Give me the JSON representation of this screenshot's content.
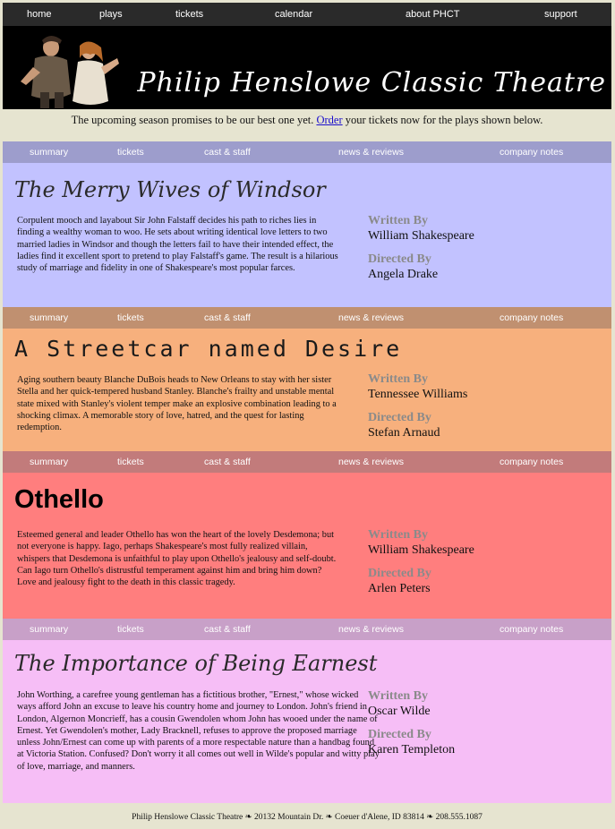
{
  "topnav": [
    "home",
    "plays",
    "tickets",
    "calendar",
    "about PHCT",
    "support"
  ],
  "banner": {
    "title": "Philip Henslowe Classic Theatre"
  },
  "intro": {
    "before": "The upcoming season promises to be our best one yet.",
    "link": "Order",
    "after": "your tickets now for the plays shown below."
  },
  "subnav": [
    "summary",
    "tickets",
    "cast & staff",
    "news & reviews",
    "company notes"
  ],
  "credit_labels": {
    "written": "Written By",
    "directed": "Directed By"
  },
  "plays": [
    {
      "title": "The Merry Wives of Windsor",
      "description": "Corpulent mooch and layabout Sir John Falstaff decides his path to riches lies in finding a wealthy woman to woo. He sets about writing identical love letters to two married ladies in Windsor and though the letters fail to have their intended effect, the ladies find it excellent sport to pretend to play Falstaff's game. The result is a hilarious study of marriage and fidelity in one of Shakespeare's most popular farces.",
      "writer": "William Shakespeare",
      "director": "Angela Drake",
      "colors": {
        "nav": "#9d9dcc",
        "body": "#c2c2ff"
      }
    },
    {
      "title": "A Streetcar named Desire",
      "description": "Aging southern beauty Blanche DuBois heads to New Orleans to stay with her sister Stella and her quick-tempered husband Stanley. Blanche's frailty and unstable mental state mixed with Stanley's violent temper make an explosive combination leading to a shocking climax. A memorable story of love, hatred, and the quest for lasting redemption.",
      "writer": "Tennessee Williams",
      "director": "Stefan Arnaud",
      "colors": {
        "nav": "#c09070",
        "body": "#f7b07d"
      }
    },
    {
      "title": "Othello",
      "description": "Esteemed general and leader Othello has won the heart of the lovely Desdemona; but not everyone is happy. Iago, perhaps Shakespeare's most fully realized villain, whispers that Desdemona is unfaithful to play upon Othello's jealousy and self-doubt. Can Iago turn Othello's distrustful temperament against him and bring him down? Love and jealousy fight to the death in this classic tragedy.",
      "writer": "William Shakespeare",
      "director": "Arlen Peters",
      "colors": {
        "nav": "#c27b7b",
        "body": "#ff7e7e"
      }
    },
    {
      "title": "The Importance of Being Earnest",
      "description": "John Worthing, a carefree young gentleman has a fictitious brother, \"Ernest,\" whose wicked ways afford John an excuse to leave his country home and journey to London. John's friend in London, Algernon Moncrieff, has a cousin Gwendolen whom John has wooed under the name of Ernest. Yet Gwendolen's mother, Lady Bracknell, refuses to approve the proposed marriage unless John/Ernest can come up with parents of a more respectable nature than a handbag found at Victoria Station. Confused? Don't worry it all comes out well in Wilde's popular and witty play of love, marriage, and manners.",
      "writer": "Oscar Wilde",
      "director": "Karen Templeton",
      "colors": {
        "nav": "#c8a0c8",
        "body": "#f6bef6"
      }
    }
  ],
  "footer": "Philip Henslowe Classic Theatre ❧ 20132 Mountain Dr. ❧ Coeuer d'Alene, ID 83814 ❧ 208.555.1087"
}
